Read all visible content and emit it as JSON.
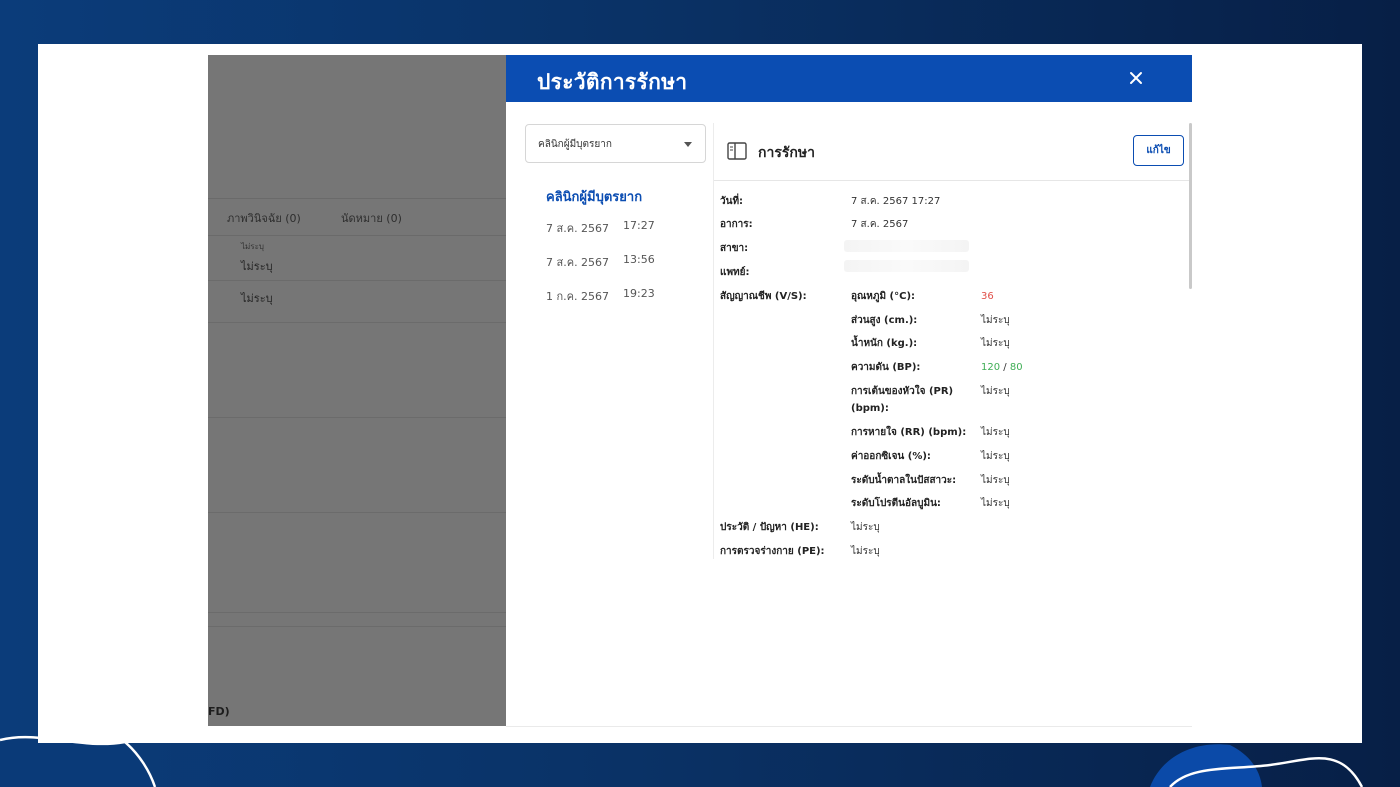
{
  "drawer": {
    "title": "ประวัติการรักษา",
    "close_icon": "close-icon"
  },
  "sidebar": {
    "select_value": "คลินิกผู้มีบุตรยาก",
    "clinic_title": "คลินิกผู้มีบุตรยาก",
    "visits": [
      {
        "date": "7 ส.ค. 2567",
        "time": "17:27"
      },
      {
        "date": "7 ส.ค. 2567",
        "time": "13:56"
      },
      {
        "date": "1 ก.ค. 2567",
        "time": "19:23"
      }
    ]
  },
  "detail": {
    "title": "การรักษา",
    "edit_label": "แก้ไข",
    "fields": {
      "date_label": "วันที่:",
      "date_value": "7 ส.ค. 2567 17:27",
      "symptom_label": "อาการ:",
      "symptom_value": "7 ส.ค. 2567",
      "branch_label": "สาขา:",
      "doctor_label": "แพทย์:",
      "vs_label": "สัญญาณชีพ (V/S):",
      "history_label": "ประวัติ / ปัญหา (HE):",
      "history_value": "ไม่ระบุ",
      "pe_label": "การตรวจร่างกาย (PE):",
      "pe_value": "ไม่ระบุ"
    },
    "vitals": {
      "temp_label": "อุณหภูมิ (°C):",
      "temp_value": "36",
      "height_label": "ส่วนสูง (cm.):",
      "height_value": "ไม่ระบุ",
      "weight_label": "น้ำหนัก (kg.):",
      "weight_value": "ไม่ระบุ",
      "bp_label": "ความดัน (BP):",
      "bp_sys": "120",
      "bp_sep": "/",
      "bp_dia": "80",
      "pr_label_1": "การเต้นของหัวใจ (PR)",
      "pr_label_2": "(bpm):",
      "pr_value": "ไม่ระบุ",
      "rr_label": "การหายใจ (RR) (bpm):",
      "rr_value": "ไม่ระบุ",
      "o2_label": "ค่าออกซิเจน (%):",
      "o2_value": "ไม่ระบุ",
      "sugar_label": "ระดับน้ำตาลในปัสสาวะ:",
      "sugar_value": "ไม่ระบุ",
      "albumin_label": "ระดับโปรตีนอัลบูมิน:",
      "albumin_value": "ไม่ระบุ"
    }
  },
  "background": {
    "tab_research": "ภาพวินิจฉัย (0)",
    "tab_appointment": "นัดหมาย (0)",
    "row1_top": "ไม่ระบุ",
    "row1": "ไม่ระบุ",
    "row2": "ไม่ระบุ",
    "footer": "FD)"
  },
  "colors": {
    "primary": "#0b4db2",
    "temp": "#e0504a",
    "bp": "#3fae55"
  }
}
